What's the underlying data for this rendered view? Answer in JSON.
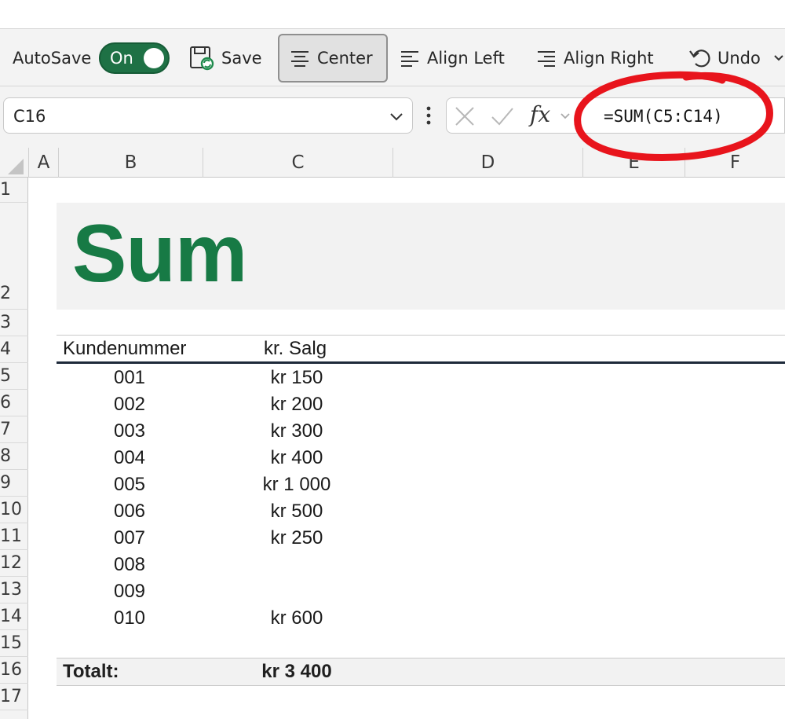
{
  "toolbar": {
    "autosave_label": "AutoSave",
    "autosave_state": "On",
    "save_label": "Save",
    "center_label": "Center",
    "align_left_label": "Align Left",
    "align_right_label": "Align Right",
    "undo_label": "Undo",
    "icons": [
      "save-icon",
      "align-center-icon",
      "align-left-icon",
      "align-right-icon",
      "undo-icon",
      "chevron-down-icon"
    ],
    "accent_color": "#1e7145"
  },
  "formula_bar": {
    "name_box": "C16",
    "fx_label": "fx",
    "formula": "=SUM(C5:C14)",
    "icons": [
      "chevron-down-icon",
      "more-options-icon",
      "cancel-icon",
      "enter-icon",
      "fx-icon"
    ]
  },
  "columns": [
    "A",
    "B",
    "C",
    "D",
    "E",
    "F"
  ],
  "rows": [
    "1",
    "2",
    "3",
    "4",
    "5",
    "6",
    "7",
    "8",
    "9",
    "10",
    "11",
    "12",
    "13",
    "14",
    "15",
    "16",
    "17"
  ],
  "sheet": {
    "title": "Sum",
    "title_color": "#177a45",
    "header_b": "Kundenummer",
    "header_c": "kr. Salg",
    "data_rows": [
      {
        "id": "001",
        "sale": "kr 150"
      },
      {
        "id": "002",
        "sale": "kr 200"
      },
      {
        "id": "003",
        "sale": "kr 300"
      },
      {
        "id": "004",
        "sale": "kr 400"
      },
      {
        "id": "005",
        "sale": "kr 1 000"
      },
      {
        "id": "006",
        "sale": "kr 500"
      },
      {
        "id": "007",
        "sale": "kr 250"
      },
      {
        "id": "008",
        "sale": ""
      },
      {
        "id": "009",
        "sale": ""
      },
      {
        "id": "010",
        "sale": "kr 600"
      }
    ],
    "total_label": "Totalt:",
    "total_value": "kr 3 400"
  },
  "annotation": {
    "shape": "hand-drawn circle around formula",
    "color": "#e8141c"
  }
}
